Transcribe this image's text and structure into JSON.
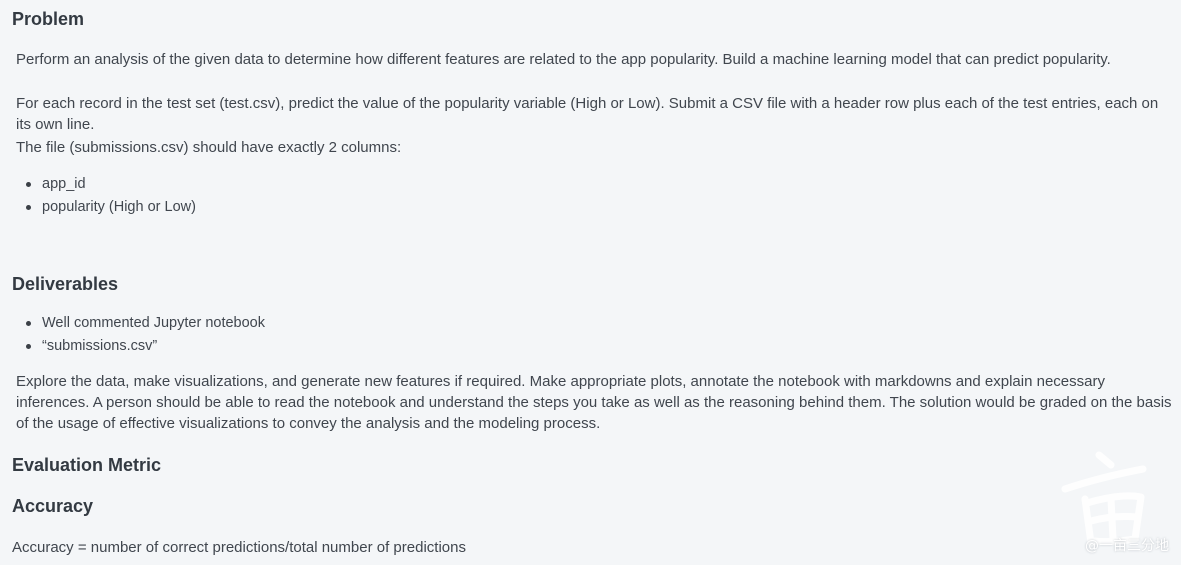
{
  "problem": {
    "heading": "Problem",
    "paragraph_1": "Perform an analysis of the given data to determine how different features are related to the app popularity.  Build a machine learning model that can predict popularity.",
    "paragraph_2": "For each record in the test set (test.csv), predict the value of the popularity variable (High or Low). Submit a CSV file with a header row plus each of the test entries, each on its own line.",
    "paragraph_3": "The file (submissions.csv) should have exactly 2 columns:",
    "columns": [
      "app_id",
      "popularity (High or Low)"
    ]
  },
  "deliverables": {
    "heading": "Deliverables",
    "items": [
      "Well commented Jupyter notebook",
      "“submissions.csv”"
    ],
    "paragraph": "Explore the data, make visualizations, and generate new features if required. Make appropriate plots, annotate the notebook with markdowns and explain necessary inferences. A person should be able to read the notebook and understand the steps you take as well as the reasoning behind them. The solution would be graded on the basis of the usage of effective visualizations to convey the analysis and the modeling process."
  },
  "evaluation": {
    "heading": "Evaluation Metric",
    "subheading": "Accuracy",
    "formula": "Accuracy = number of correct predictions/total number of predictions"
  },
  "watermark": {
    "text": "@一亩三分地"
  }
}
